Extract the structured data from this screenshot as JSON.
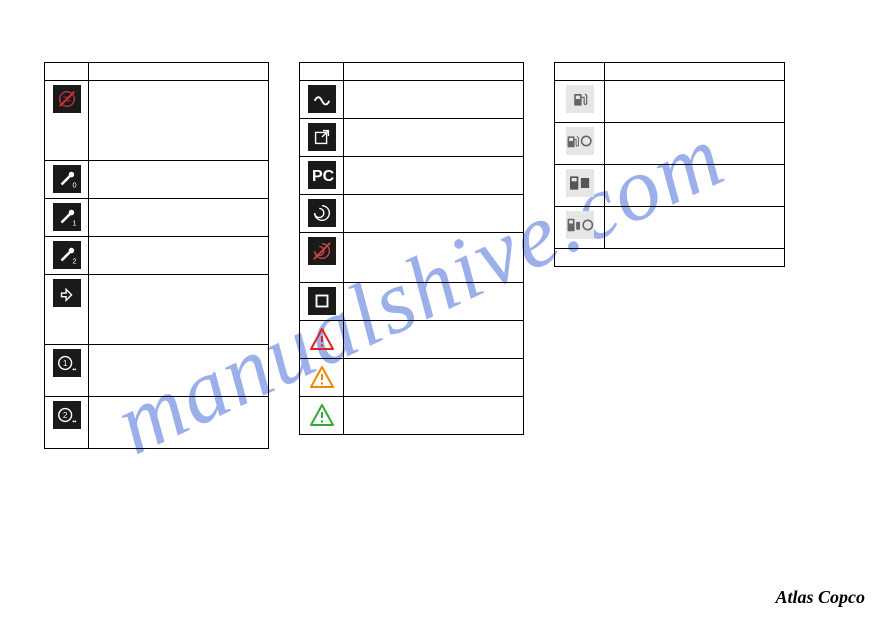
{
  "watermark": "manualshive.com",
  "brand": "Atlas Copco",
  "table1": {
    "header": {
      "icon": "",
      "desc": ""
    },
    "rows": [
      {
        "icon": "no-generator-icon",
        "desc": "",
        "tall": true
      },
      {
        "icon": "wrench-0-icon",
        "desc": ""
      },
      {
        "icon": "wrench-1-icon",
        "desc": ""
      },
      {
        "icon": "wrench-2-icon",
        "desc": ""
      },
      {
        "icon": "arrow-loop-icon",
        "desc": "",
        "tall": true
      },
      {
        "icon": "circle-1-icon",
        "desc": "",
        "tall": true
      },
      {
        "icon": "circle-2-icon",
        "desc": "",
        "tall": true
      }
    ]
  },
  "table2": {
    "header": {
      "icon": "",
      "desc": ""
    },
    "rows": [
      {
        "icon": "wave-icon",
        "desc": ""
      },
      {
        "icon": "external-icon",
        "desc": ""
      },
      {
        "icon": "pc-icon",
        "desc": ""
      },
      {
        "icon": "swirl-icon",
        "desc": ""
      },
      {
        "icon": "swirl-off-icon",
        "desc": "",
        "tall": true
      },
      {
        "icon": "port-icon",
        "desc": ""
      },
      {
        "icon": "warning-red-icon",
        "desc": ""
      },
      {
        "icon": "warning-orange-icon",
        "desc": ""
      },
      {
        "icon": "warning-green-icon",
        "desc": ""
      }
    ]
  },
  "table3": {
    "header": {
      "icon": "",
      "desc": ""
    },
    "rows": [
      {
        "icon": "fuel-icon",
        "desc": ""
      },
      {
        "icon": "fuel-circle-icon",
        "desc": ""
      },
      {
        "icon": "cylinder-dark-icon",
        "desc": ""
      },
      {
        "icon": "cylinder-circle-icon",
        "desc": ""
      }
    ],
    "footer": {
      "desc": ""
    }
  }
}
